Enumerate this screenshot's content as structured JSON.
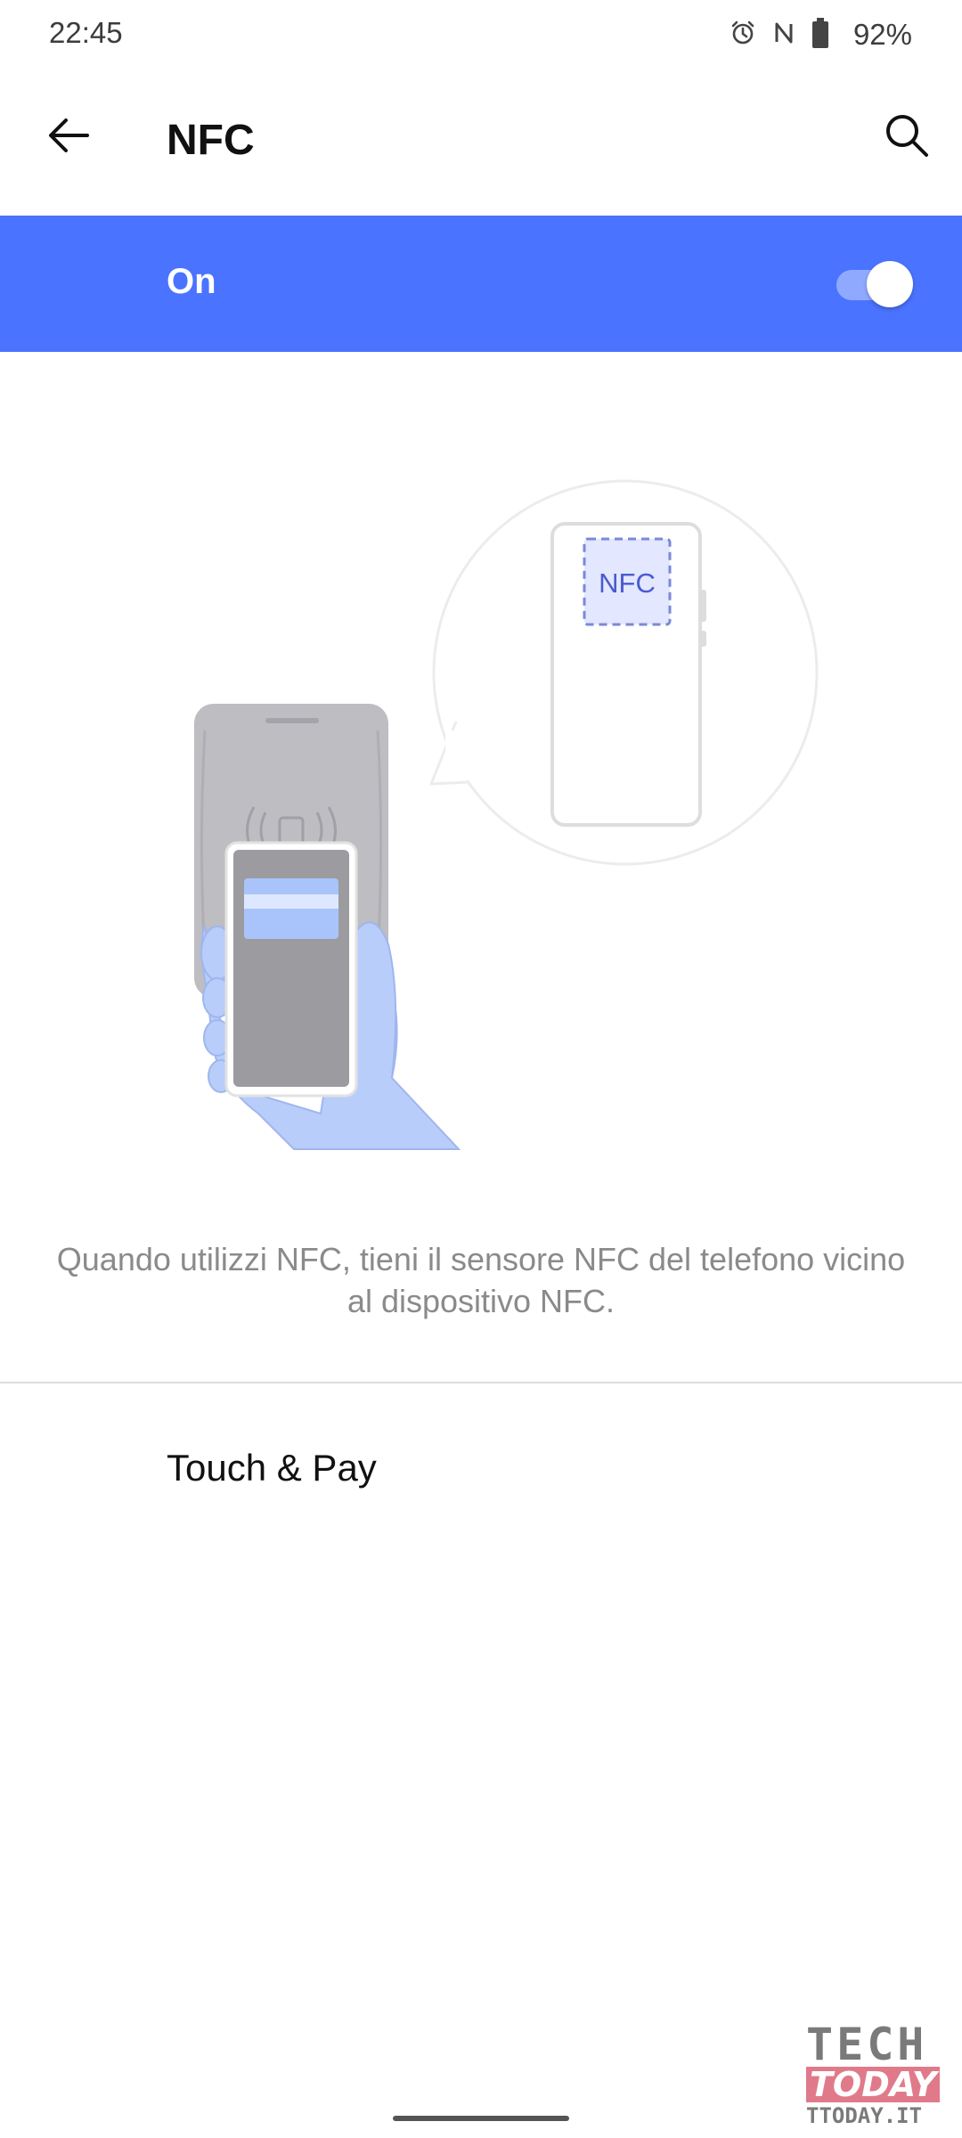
{
  "status_bar": {
    "time": "22:45",
    "icons": [
      "alarm-icon",
      "nfc-status-icon",
      "battery-icon"
    ],
    "battery_percent": "92%"
  },
  "app_bar": {
    "title": "NFC",
    "back_icon": "back-arrow-icon",
    "search_icon": "search-icon"
  },
  "toggle": {
    "label": "On",
    "enabled": true,
    "bar_color": "#4a73ff"
  },
  "illustration": {
    "nfc_label": "NFC"
  },
  "description": "Quando utilizzi NFC, tieni il sensore NFC del telefono vicino al dispositivo NFC.",
  "list": {
    "items": [
      {
        "label": "Touch & Pay"
      }
    ]
  },
  "watermark": {
    "line1": "TECH",
    "line2": "TODAY",
    "line3": "TTODAY.IT"
  }
}
